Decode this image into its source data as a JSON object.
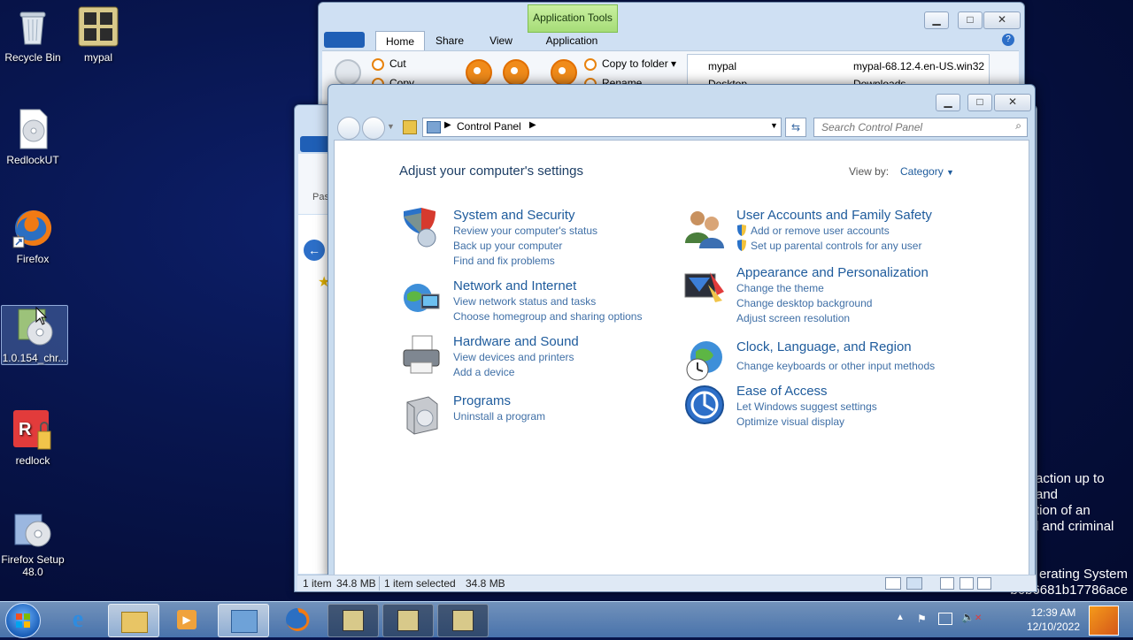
{
  "desktop": {
    "icons": [
      {
        "label": "Recycle Bin"
      },
      {
        "label": "mypal"
      },
      {
        "label": "RedlockUT"
      },
      {
        "label": "Firefox"
      },
      {
        "label": "1.0.154_chr..."
      },
      {
        "label": "redlock"
      },
      {
        "label": "Firefox Setup 48.0"
      }
    ],
    "watermark_lines": [
      "action up to and",
      "tion of an",
      "l and criminal"
    ],
    "watermark_bottom": [
      "erating System",
      "b6b6681b17786ace"
    ]
  },
  "explorer_back": {
    "context_tab": "Application Tools",
    "tabs": [
      "Home",
      "Share",
      "View",
      "Application"
    ],
    "ribbon": {
      "cut": "Cut",
      "copy": "Copy",
      "copy_to": "Copy to folder ▾",
      "rename": "Rename"
    },
    "files": {
      "f1": "mypal",
      "f2": "mypal-68.12.4.en-US.win32",
      "f3": "Desktop",
      "f4": "Downloads"
    },
    "partial_label": "Past"
  },
  "statusbar": {
    "items": "1 item",
    "size1": "34.8 MB",
    "selected": "1 item selected",
    "size2": "34.8 MB"
  },
  "control_panel": {
    "breadcrumb": "Control Panel",
    "search_placeholder": "Search Control Panel",
    "heading": "Adjust your computer's settings",
    "view_by_label": "View by:",
    "view_by_value": "Category",
    "categories": [
      {
        "title": "System and Security",
        "links": [
          "Review your computer's status",
          "Back up your computer",
          "Find and fix problems"
        ]
      },
      {
        "title": "Network and Internet",
        "links": [
          "View network status and tasks",
          "Choose homegroup and sharing options"
        ]
      },
      {
        "title": "Hardware and Sound",
        "links": [
          "View devices and printers",
          "Add a device"
        ]
      },
      {
        "title": "Programs",
        "links": [
          "Uninstall a program"
        ]
      },
      {
        "title": "User Accounts and Family Safety",
        "links": [
          "Add or remove user accounts",
          "Set up parental controls for any user"
        ]
      },
      {
        "title": "Appearance and Personalization",
        "links": [
          "Change the theme",
          "Change desktop background",
          "Adjust screen resolution"
        ]
      },
      {
        "title": "Clock, Language, and Region",
        "links": [
          "Change keyboards or other input methods"
        ]
      },
      {
        "title": "Ease of Access",
        "links": [
          "Let Windows suggest settings",
          "Optimize visual display"
        ]
      }
    ]
  },
  "taskbar": {
    "time": "12:39 AM",
    "date": "12/10/2022"
  }
}
